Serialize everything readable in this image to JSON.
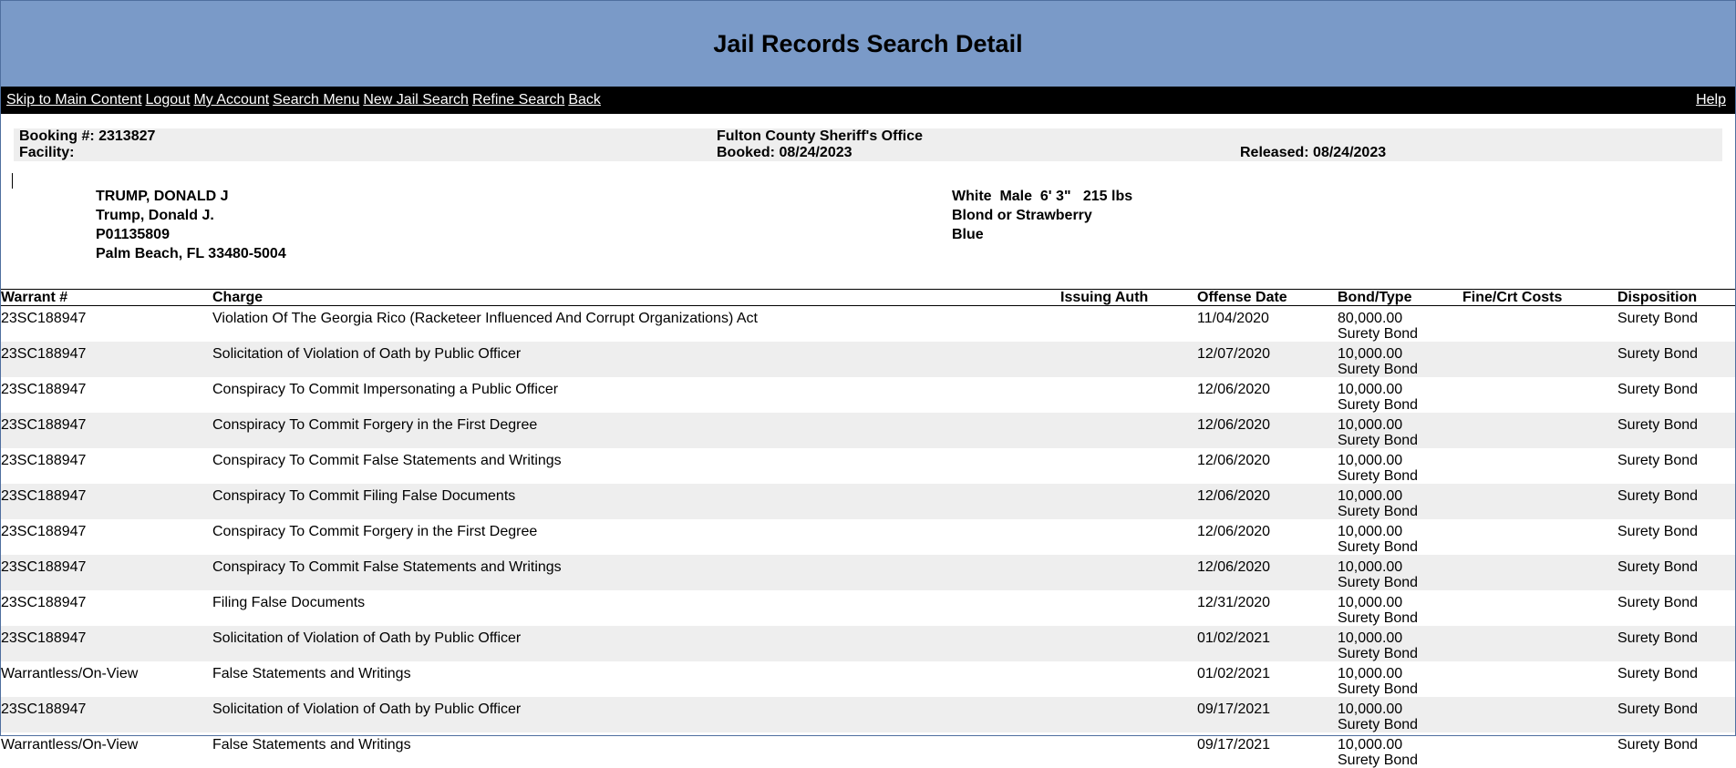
{
  "page": {
    "title": "Jail Records Search Detail"
  },
  "nav": {
    "links": [
      "Skip to Main Content",
      "Logout",
      "My Account",
      "Search Menu",
      "New Jail Search",
      "Refine Search",
      "Back"
    ],
    "help": "Help"
  },
  "booking": {
    "number": "Booking #: 2313827",
    "facility": "Facility:",
    "agency": "Fulton County Sheriff's Office",
    "booked": "Booked: 08/24/2023",
    "released": "Released: 08/24/2023"
  },
  "person": {
    "name_upper": "TRUMP, DONALD J",
    "name": "Trump, Donald J.",
    "id": "P01135809",
    "location": "Palm Beach, FL 33480-5004",
    "physical": "White  Male  6' 3\"   215 lbs",
    "hair": "Blond or Strawberry",
    "eyes": "Blue"
  },
  "table": {
    "headers": [
      "Warrant #",
      "Charge",
      "Issuing Auth",
      "Offense Date",
      "Bond/Type",
      "Fine/Crt Costs",
      "Disposition"
    ],
    "rows": [
      {
        "warrant": "23SC188947",
        "charge": "Violation Of The Georgia Rico (Racketeer Influenced And Corrupt Organizations) Act",
        "auth": "",
        "date": "11/04/2020",
        "bond": "80,000.00",
        "bond_type": "Surety Bond",
        "fine": "",
        "disposition": "Surety Bond"
      },
      {
        "warrant": "23SC188947",
        "charge": "Solicitation of Violation of Oath by Public Officer",
        "auth": "",
        "date": "12/07/2020",
        "bond": "10,000.00",
        "bond_type": "Surety Bond",
        "fine": "",
        "disposition": "Surety Bond"
      },
      {
        "warrant": "23SC188947",
        "charge": "Conspiracy To Commit Impersonating a Public Officer",
        "auth": "",
        "date": "12/06/2020",
        "bond": "10,000.00",
        "bond_type": "Surety Bond",
        "fine": "",
        "disposition": "Surety Bond"
      },
      {
        "warrant": "23SC188947",
        "charge": "Conspiracy To Commit Forgery in the First Degree",
        "auth": "",
        "date": "12/06/2020",
        "bond": "10,000.00",
        "bond_type": "Surety Bond",
        "fine": "",
        "disposition": "Surety Bond"
      },
      {
        "warrant": "23SC188947",
        "charge": "Conspiracy To Commit False Statements and Writings",
        "auth": "",
        "date": "12/06/2020",
        "bond": "10,000.00",
        "bond_type": "Surety Bond",
        "fine": "",
        "disposition": "Surety Bond"
      },
      {
        "warrant": "23SC188947",
        "charge": "Conspiracy To Commit Filing False Documents",
        "auth": "",
        "date": "12/06/2020",
        "bond": "10,000.00",
        "bond_type": "Surety Bond",
        "fine": "",
        "disposition": "Surety Bond"
      },
      {
        "warrant": "23SC188947",
        "charge": "Conspiracy To Commit Forgery in the First Degree",
        "auth": "",
        "date": "12/06/2020",
        "bond": "10,000.00",
        "bond_type": "Surety Bond",
        "fine": "",
        "disposition": "Surety Bond"
      },
      {
        "warrant": "23SC188947",
        "charge": "Conspiracy To Commit False Statements and Writings",
        "auth": "",
        "date": "12/06/2020",
        "bond": "10,000.00",
        "bond_type": "Surety Bond",
        "fine": "",
        "disposition": "Surety Bond"
      },
      {
        "warrant": "23SC188947",
        "charge": "Filing False Documents",
        "auth": "",
        "date": "12/31/2020",
        "bond": "10,000.00",
        "bond_type": "Surety Bond",
        "fine": "",
        "disposition": "Surety Bond"
      },
      {
        "warrant": "23SC188947",
        "charge": "Solicitation of Violation of Oath by Public Officer",
        "auth": "",
        "date": "01/02/2021",
        "bond": "10,000.00",
        "bond_type": "Surety Bond",
        "fine": "",
        "disposition": "Surety Bond"
      },
      {
        "warrant": "Warrantless/On-View",
        "charge": "False Statements and Writings",
        "auth": "",
        "date": "01/02/2021",
        "bond": "10,000.00",
        "bond_type": "Surety Bond",
        "fine": "",
        "disposition": "Surety Bond"
      },
      {
        "warrant": "23SC188947",
        "charge": "Solicitation of Violation of Oath by Public Officer",
        "auth": "",
        "date": "09/17/2021",
        "bond": "10,000.00",
        "bond_type": "Surety Bond",
        "fine": "",
        "disposition": "Surety Bond"
      },
      {
        "warrant": "Warrantless/On-View",
        "charge": "False Statements and Writings",
        "auth": "",
        "date": "09/17/2021",
        "bond": "10,000.00",
        "bond_type": "Surety Bond",
        "fine": "",
        "disposition": "Surety Bond"
      }
    ]
  }
}
